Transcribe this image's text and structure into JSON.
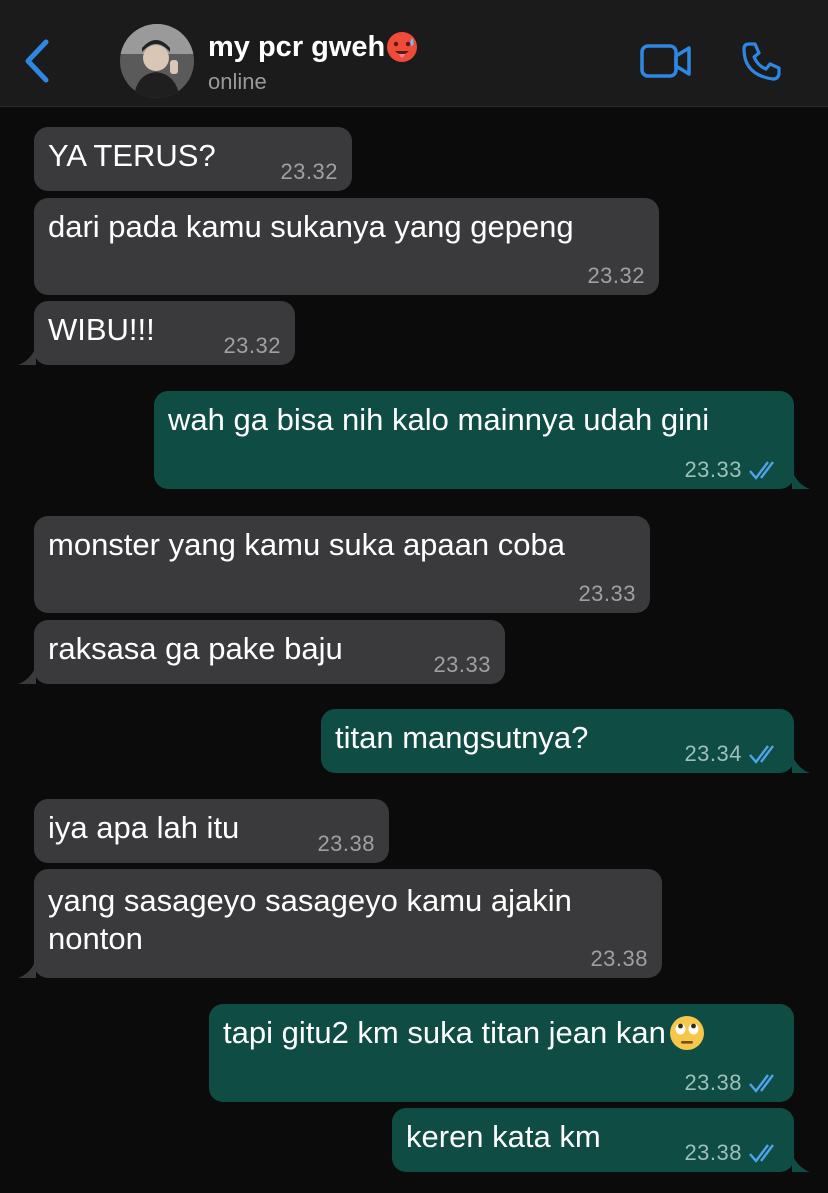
{
  "header": {
    "contact_name": "my pcr gweh",
    "status": "online",
    "name_emoji": "hot-face-emoji",
    "accent_color": "#2f87e4"
  },
  "messages": [
    {
      "dir": "in",
      "text": "YA TERUS?",
      "time": "23.32"
    },
    {
      "dir": "in",
      "text": "dari pada kamu sukanya yang gepeng",
      "time": "23.32"
    },
    {
      "dir": "in",
      "text": "WIBU!!!",
      "time": "23.32"
    },
    {
      "dir": "out",
      "text": "wah ga bisa nih kalo mainnya udah gini",
      "time": "23.33",
      "status": "read"
    },
    {
      "dir": "in",
      "text": "monster yang kamu suka apaan coba",
      "time": "23.33"
    },
    {
      "dir": "in",
      "text": "raksasa ga pake baju",
      "time": "23.33"
    },
    {
      "dir": "out",
      "text": "titan mangsutnya?",
      "time": "23.34",
      "status": "read"
    },
    {
      "dir": "in",
      "text": "iya apa lah itu",
      "time": "23.38"
    },
    {
      "dir": "in",
      "text": "yang sasageyo sasageyo kamu ajakin nonton",
      "time": "23.38"
    },
    {
      "dir": "out",
      "text": "tapi gitu2 km suka titan jean kan",
      "time": "23.38",
      "status": "read",
      "emoji": "face-with-rolling-eyes-emoji"
    },
    {
      "dir": "out",
      "text": "keren kata km",
      "time": "23.38",
      "status": "read"
    }
  ],
  "colors": {
    "incoming_bubble": "#3a3a3c",
    "outgoing_bubble": "#0e4c44",
    "read_ticks": "#4fa3e8",
    "background": "#0b0b0b"
  }
}
